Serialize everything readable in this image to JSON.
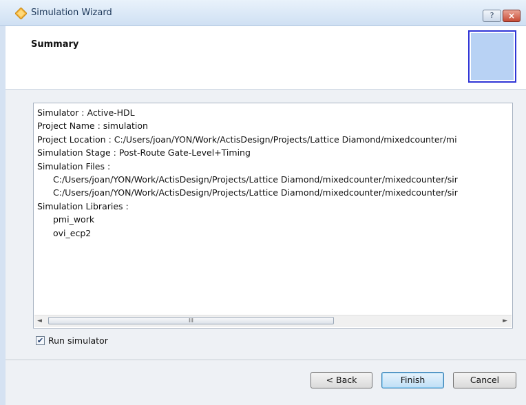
{
  "window": {
    "title": "Simulation Wizard",
    "help_label": "?",
    "close_label": "×"
  },
  "header": {
    "title": "Summary"
  },
  "summary": {
    "lines": [
      "Simulator : Active-HDL",
      "Project Name : simulation",
      "Project Location : C:/Users/joan/YON/Work/ActisDesign/Projects/Lattice Diamond/mixedcounter/mi",
      "Simulation Stage : Post-Route Gate-Level+Timing",
      "Simulation Files :",
      "C:/Users/joan/YON/Work/ActisDesign/Projects/Lattice Diamond/mixedcounter/mixedcounter/sir",
      "C:/Users/joan/YON/Work/ActisDesign/Projects/Lattice Diamond/mixedcounter/mixedcounter/sir",
      "Simulation Libraries :",
      "pmi_work",
      "ovi_ecp2"
    ],
    "scroll_left": "◄",
    "scroll_right": "►",
    "scroll_thumb": "III"
  },
  "run_simulator": {
    "label": "Run simulator",
    "checked": true,
    "check_mark": "✔"
  },
  "buttons": {
    "back": "< Back",
    "finish": "Finish",
    "cancel": "Cancel"
  }
}
